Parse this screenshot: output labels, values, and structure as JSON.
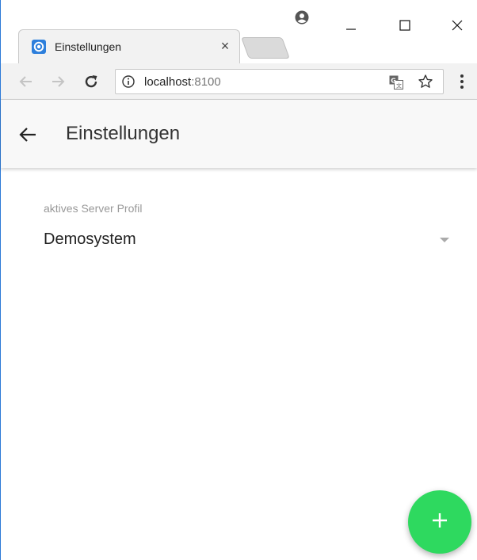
{
  "browser": {
    "tab": {
      "title": "Einstellungen",
      "close": "×"
    },
    "omnibox": {
      "host": "localhost",
      "port": ":8100"
    }
  },
  "app": {
    "header": {
      "title": "Einstellungen"
    },
    "settings": {
      "server_profile_label": "aktives Server Profil",
      "server_profile_value": "Demosystem"
    }
  },
  "colors": {
    "fab": "#2ed95f",
    "window_border": "#2b79d7",
    "favicon": "#2d7fdc"
  },
  "icons": {
    "back": "arrow-left",
    "fab": "plus",
    "profile": "account-circle",
    "translate": "translate",
    "bookmark": "star-outline",
    "menu": "more-vertical"
  }
}
